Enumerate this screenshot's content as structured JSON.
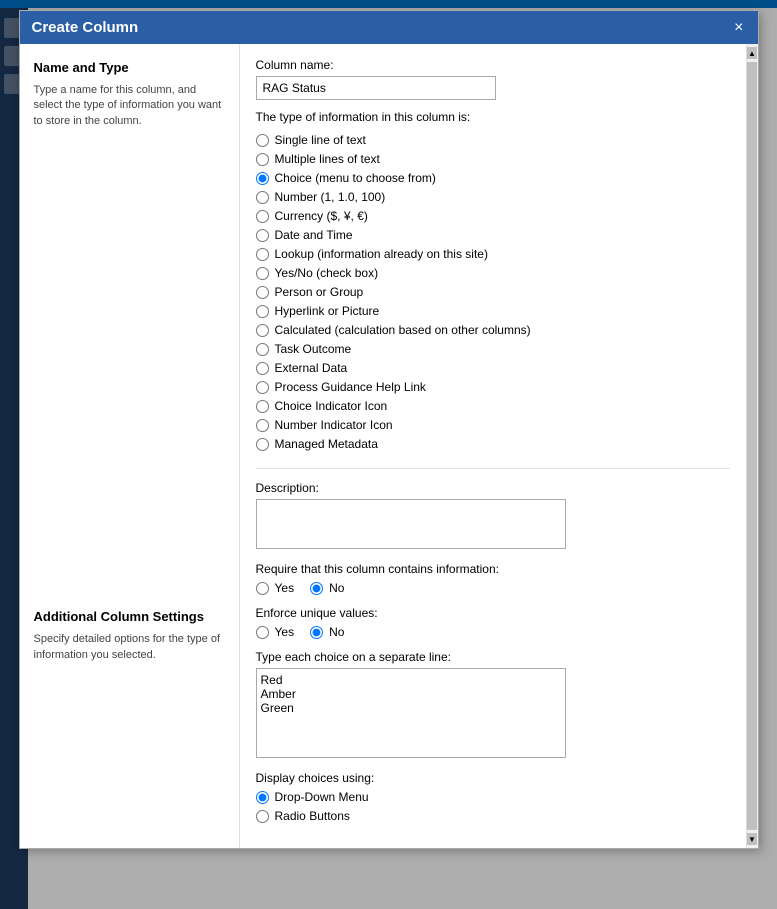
{
  "dialog": {
    "title": "Create Column",
    "close_button": "×"
  },
  "left_panel": {
    "section1": {
      "title": "Name and Type",
      "description": "Type a name for this column, and select the type of information you want to store in the column."
    },
    "section2": {
      "title": "Additional Column Settings",
      "description": "Specify detailed options for the type of information you selected."
    }
  },
  "right_panel": {
    "column_name_label": "Column name:",
    "column_name_value": "RAG Status",
    "type_label": "The type of information in this column is:",
    "type_options": [
      {
        "id": "opt_single",
        "label": "Single line of text",
        "checked": false
      },
      {
        "id": "opt_multi",
        "label": "Multiple lines of text",
        "checked": false
      },
      {
        "id": "opt_choice",
        "label": "Choice (menu to choose from)",
        "checked": true
      },
      {
        "id": "opt_number",
        "label": "Number (1, 1.0, 100)",
        "checked": false
      },
      {
        "id": "opt_currency",
        "label": "Currency ($, ¥, €)",
        "checked": false
      },
      {
        "id": "opt_datetime",
        "label": "Date and Time",
        "checked": false
      },
      {
        "id": "opt_lookup",
        "label": "Lookup (information already on this site)",
        "checked": false
      },
      {
        "id": "opt_yesno",
        "label": "Yes/No (check box)",
        "checked": false
      },
      {
        "id": "opt_person",
        "label": "Person or Group",
        "checked": false
      },
      {
        "id": "opt_hyperlink",
        "label": "Hyperlink or Picture",
        "checked": false
      },
      {
        "id": "opt_calculated",
        "label": "Calculated (calculation based on other columns)",
        "checked": false
      },
      {
        "id": "opt_task",
        "label": "Task Outcome",
        "checked": false
      },
      {
        "id": "opt_external",
        "label": "External Data",
        "checked": false
      },
      {
        "id": "opt_process",
        "label": "Process Guidance Help Link",
        "checked": false
      },
      {
        "id": "opt_choice_icon",
        "label": "Choice Indicator Icon",
        "checked": false
      },
      {
        "id": "opt_number_icon",
        "label": "Number Indicator Icon",
        "checked": false
      },
      {
        "id": "opt_managed",
        "label": "Managed Metadata",
        "checked": false
      }
    ],
    "additional": {
      "description_label": "Description:",
      "description_value": "",
      "require_label": "Require that this column contains information:",
      "require_options": [
        {
          "id": "req_yes",
          "label": "Yes",
          "checked": false
        },
        {
          "id": "req_no",
          "label": "No",
          "checked": true
        }
      ],
      "unique_label": "Enforce unique values:",
      "unique_options": [
        {
          "id": "uniq_yes",
          "label": "Yes",
          "checked": false
        },
        {
          "id": "uniq_no",
          "label": "No",
          "checked": true
        }
      ],
      "choices_label": "Type each choice on a separate line:",
      "choices_value": "Red\nAmber\nGreen",
      "display_label": "Display choices using:",
      "display_options": [
        {
          "id": "disp_dropdown",
          "label": "Drop-Down Menu",
          "checked": true
        },
        {
          "id": "disp_radio",
          "label": "Radio Buttons",
          "checked": false
        }
      ]
    }
  }
}
